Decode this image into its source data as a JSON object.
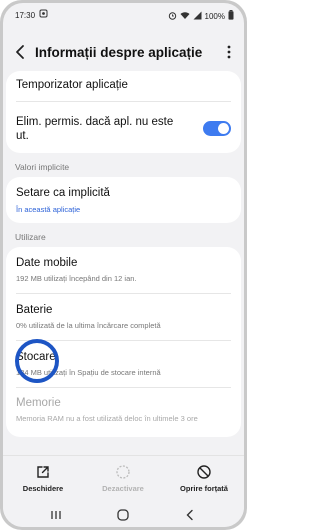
{
  "status": {
    "time": "17:30",
    "battery": "100%"
  },
  "header": {
    "title": "Informații despre aplicație"
  },
  "rows": {
    "timer": {
      "title": "Temporizator aplicație"
    },
    "remove_perms": {
      "title": "Elim. permis. dacă apl. nu este ut.",
      "enabled": true
    },
    "set_default": {
      "title": "Setare ca implicită",
      "subtitle": "În această aplicație"
    },
    "mobile_data": {
      "title": "Date mobile",
      "subtitle": "192 MB utilizați începând din 12 ian."
    },
    "battery": {
      "title": "Baterie",
      "subtitle": "0% utilizată de la ultima încărcare completă"
    },
    "storage": {
      "title": "Stocare",
      "subtitle": "184 MB utilizați în Spațiu de stocare internă"
    },
    "memory": {
      "title": "Memorie",
      "subtitle": "Memoria RAM nu a fost utilizată deloc în ultimele 3 ore"
    }
  },
  "sections": {
    "defaults": "Valori implicite",
    "usage": "Utilizare"
  },
  "actions": {
    "open": "Deschidere",
    "disable": "Dezactivare",
    "force_stop": "Oprire forțată"
  },
  "colors": {
    "accent": "#3e7bf0",
    "link": "#2e63d8",
    "highlight": "#1d55c4"
  }
}
